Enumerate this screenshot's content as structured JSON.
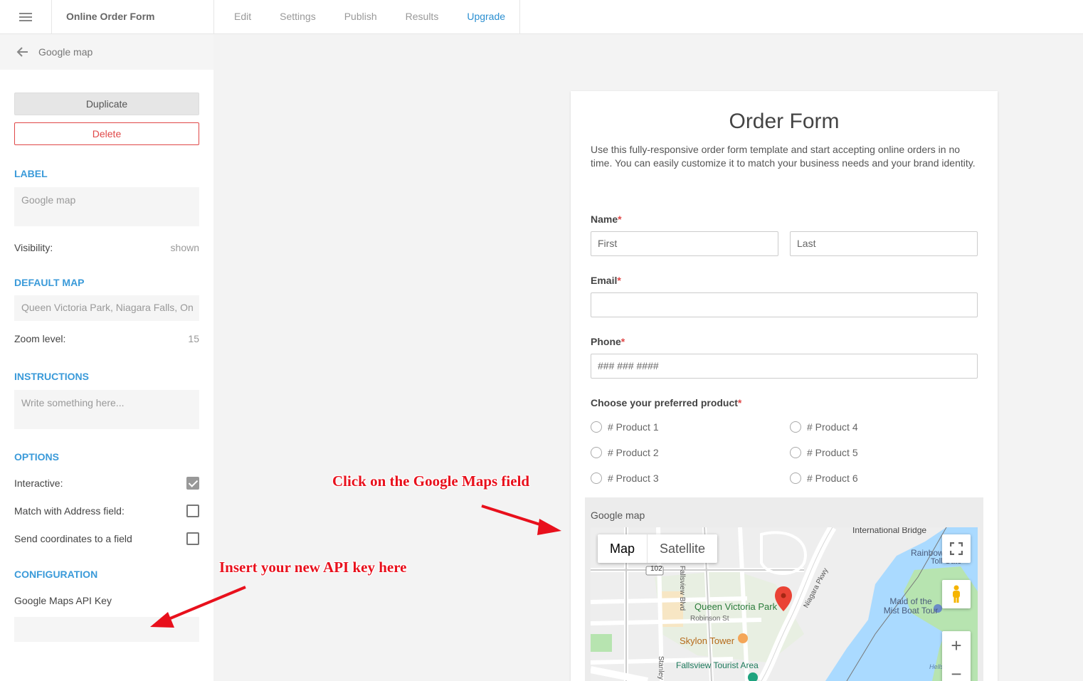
{
  "topbar": {
    "app_title": "Online Order Form",
    "nav": [
      {
        "label": "Edit"
      },
      {
        "label": "Settings"
      },
      {
        "label": "Publish"
      },
      {
        "label": "Results"
      },
      {
        "label": "Upgrade",
        "active": true
      }
    ]
  },
  "sidebar": {
    "header_title": "Google map",
    "duplicate_label": "Duplicate",
    "delete_label": "Delete",
    "label_section": "LABEL",
    "label_value": "Google map",
    "visibility_label": "Visibility:",
    "visibility_value": "shown",
    "default_map_section": "DEFAULT MAP",
    "default_map_value": "Queen Victoria Park, Niagara Falls, On",
    "zoom_label": "Zoom level:",
    "zoom_value": "15",
    "instructions_section": "INSTRUCTIONS",
    "instructions_placeholder": "Write something here...",
    "options_section": "OPTIONS",
    "interactive_label": "Interactive:",
    "interactive_checked": true,
    "match_address_label": "Match with Address field:",
    "match_address_checked": false,
    "send_coords_label": "Send coordinates to a field",
    "send_coords_checked": false,
    "configuration_section": "CONFIGURATION",
    "api_key_label": "Google Maps API Key",
    "api_key_value": ""
  },
  "form": {
    "title": "Order Form",
    "description": "Use this fully-responsive order form template and start accepting online orders in no time. You can easily customize it to match your business needs and your brand identity.",
    "required_mark": "*",
    "name_label": "Name",
    "first_placeholder": "First",
    "last_placeholder": "Last",
    "email_label": "Email",
    "phone_label": "Phone",
    "phone_placeholder": "### ### ####",
    "product_label": "Choose your preferred product",
    "products": [
      "# Product 1",
      "# Product 2",
      "# Product 3",
      "# Product 4",
      "# Product 5",
      "# Product 6"
    ],
    "map_label": "Google map",
    "map_types": [
      "Map",
      "Satellite"
    ],
    "map_places": {
      "park": "Queen Victoria Park",
      "tower": "Skylon Tower",
      "tourist": "Fallsview Tourist Area",
      "boat": "Maid of the Mist Boat Tour",
      "bridge": "International Bridge",
      "robinson": "Robinson St",
      "niagara": "Niagara Pkwy",
      "fallsview": "Fallsview Blvd",
      "highway": "102",
      "stanley": "Stanley",
      "rainbow": "Rainbow",
      "toll": "Toll Gate",
      "hells": "Hells"
    }
  },
  "annotations": {
    "click_map": "Click on the Google Maps field",
    "insert_key": "Insert your new API key here"
  },
  "colors": {
    "accent": "#3a9ad9",
    "danger": "#e04848",
    "annotation": "#e8101c",
    "water": "#aadaff",
    "park": "#b7e4b0"
  }
}
